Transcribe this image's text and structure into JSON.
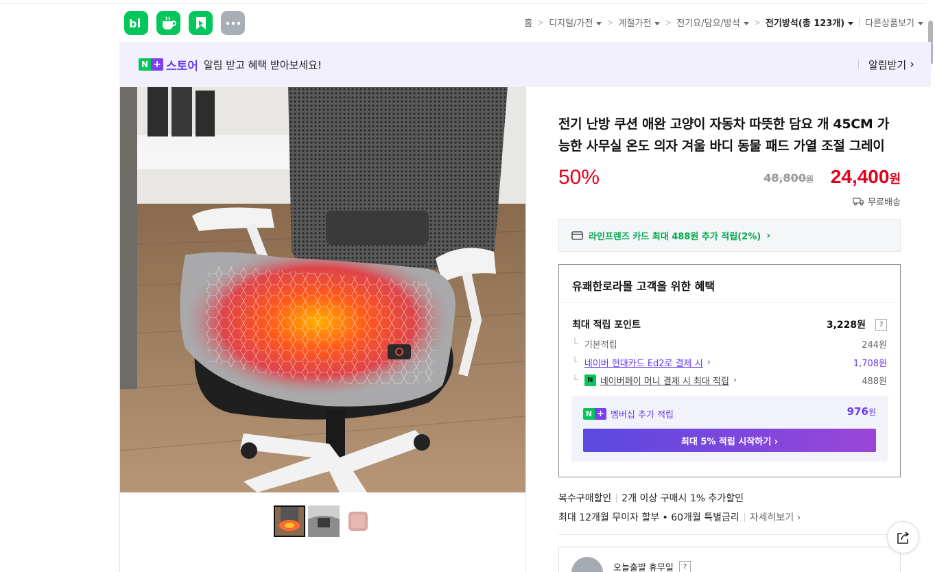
{
  "apps": [
    {
      "name": "blog-app",
      "glyph": "b|"
    },
    {
      "name": "cafe-app",
      "glyph": "☕"
    },
    {
      "name": "bookmark-app",
      "glyph": "◣"
    },
    {
      "name": "more-apps",
      "glyph": "•••"
    }
  ],
  "breadcrumb": {
    "home": "홈",
    "items": [
      "디지털/가전",
      "계절가전",
      "전기요/담요/방석"
    ],
    "current": "전기방석(총 123개)",
    "other": "다른상품보기"
  },
  "banner": {
    "logo_n": "N",
    "logo_plus": "+",
    "store": "스토어",
    "message": "알림 받고 혜택 받아보세요!",
    "alarm_label": "알림받기",
    "alarm_chevron": "›"
  },
  "product": {
    "title": "전기 난방 쿠션 애완 고양이 자동차 따뜻한 담요 개 45CM 가능한 사무실 온도 의자 겨울 바디 동물 패드 가열 조절 그레이",
    "discount": "50%",
    "original_price": "48,800",
    "original_unit": "원",
    "sale_price": "24,400",
    "sale_unit": "원",
    "shipping": "무료배송"
  },
  "card_promo": {
    "text": "라인프렌즈 카드 최대 488원 추가 적립(2%)",
    "chevron": "›"
  },
  "benefits": {
    "title": "유쾌한로라몰 고객을 위한 혜택",
    "max_points_label": "최대 적립 포인트",
    "max_points_value": "3,228원",
    "help": "?",
    "rows": [
      {
        "label": "기본적립",
        "value": "244원"
      },
      {
        "label": "네이버 현대카드 Ed2로 결제 시",
        "value": "1,708원"
      },
      {
        "label": "네이버페이 머니 결제 시 최대 적립",
        "value": "488원"
      }
    ],
    "npay_icon": "N",
    "membership_label": "멤버십 추가 적립",
    "membership_value": "976",
    "membership_unit": "원",
    "membership_button": "최대 5% 적립 시작하기 ›"
  },
  "multi_discount": {
    "label": "복수구매할인",
    "text": "2개 이상 구매시 1% 추가할인"
  },
  "installment": {
    "text": "최대 12개월 무이자 할부 • 60개월 특별금리",
    "more": "자세히보기 ›"
  },
  "delivery": {
    "label": "오늘출발 휴무일",
    "help": "?"
  },
  "colors": {
    "naver_green": "#03c75a",
    "price_red": "#e3001b",
    "purple": "#6a3cf0"
  }
}
